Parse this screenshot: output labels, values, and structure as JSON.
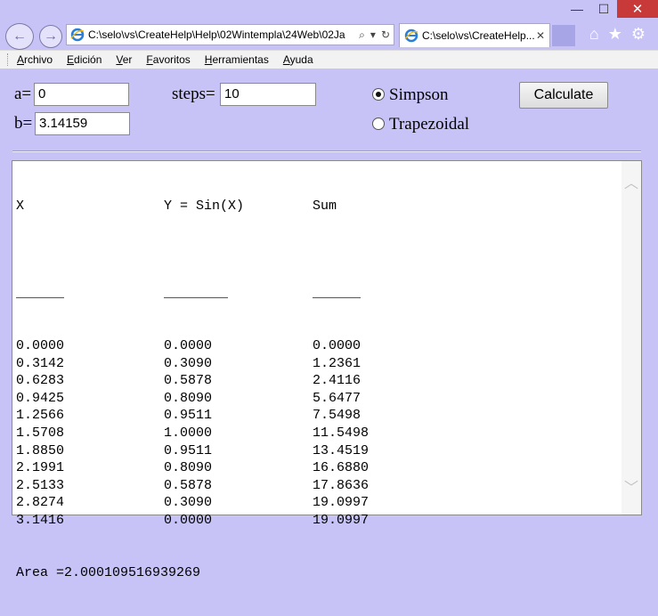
{
  "window": {
    "minimize_glyph": "—",
    "maximize_glyph": "☐",
    "close_glyph": "✕"
  },
  "browser": {
    "address": "C:\\selo\\vs\\CreateHelp\\Help\\02Wintempla\\24Web\\02Ja",
    "tab_title": "C:\\selo\\vs\\CreateHelp...",
    "back_glyph": "←",
    "forward_glyph": "→",
    "search_glyph": "⌕",
    "dropdown_glyph": "▾",
    "refresh_glyph": "↻",
    "tab_close_glyph": "✕",
    "home_glyph": "⌂",
    "star_glyph": "★",
    "gear_glyph": "⚙"
  },
  "menu": {
    "items": [
      {
        "label": "Archivo"
      },
      {
        "label": "Edición"
      },
      {
        "label": "Ver"
      },
      {
        "label": "Favoritos"
      },
      {
        "label": "Herramientas"
      },
      {
        "label": "Ayuda"
      }
    ]
  },
  "form": {
    "a_label": "a=",
    "a_value": "0",
    "b_label": "b=",
    "b_value": "3.14159",
    "steps_label": "steps=",
    "steps_value": "10",
    "simpson_label": "Simpson",
    "trapezoidal_label": "Trapezoidal",
    "simpson_selected": true,
    "calculate_label": "Calculate"
  },
  "output": {
    "headers": [
      "X",
      "Y = Sin(X)",
      "Sum"
    ],
    "underline": [
      "______",
      "________",
      "______"
    ],
    "rows": [
      [
        "0.0000",
        "0.0000",
        "0.0000"
      ],
      [
        "0.3142",
        "0.3090",
        "1.2361"
      ],
      [
        "0.6283",
        "0.5878",
        "2.4116"
      ],
      [
        "0.9425",
        "0.8090",
        "5.6477"
      ],
      [
        "1.2566",
        "0.9511",
        "7.5498"
      ],
      [
        "1.5708",
        "1.0000",
        "11.5498"
      ],
      [
        "1.8850",
        "0.9511",
        "13.4519"
      ],
      [
        "2.1991",
        "0.8090",
        "16.6880"
      ],
      [
        "2.5133",
        "0.5878",
        "17.8636"
      ],
      [
        "2.8274",
        "0.3090",
        "19.0997"
      ],
      [
        "3.1416",
        "0.0000",
        "19.0997"
      ]
    ],
    "area": "Area =2.000109516939269"
  }
}
